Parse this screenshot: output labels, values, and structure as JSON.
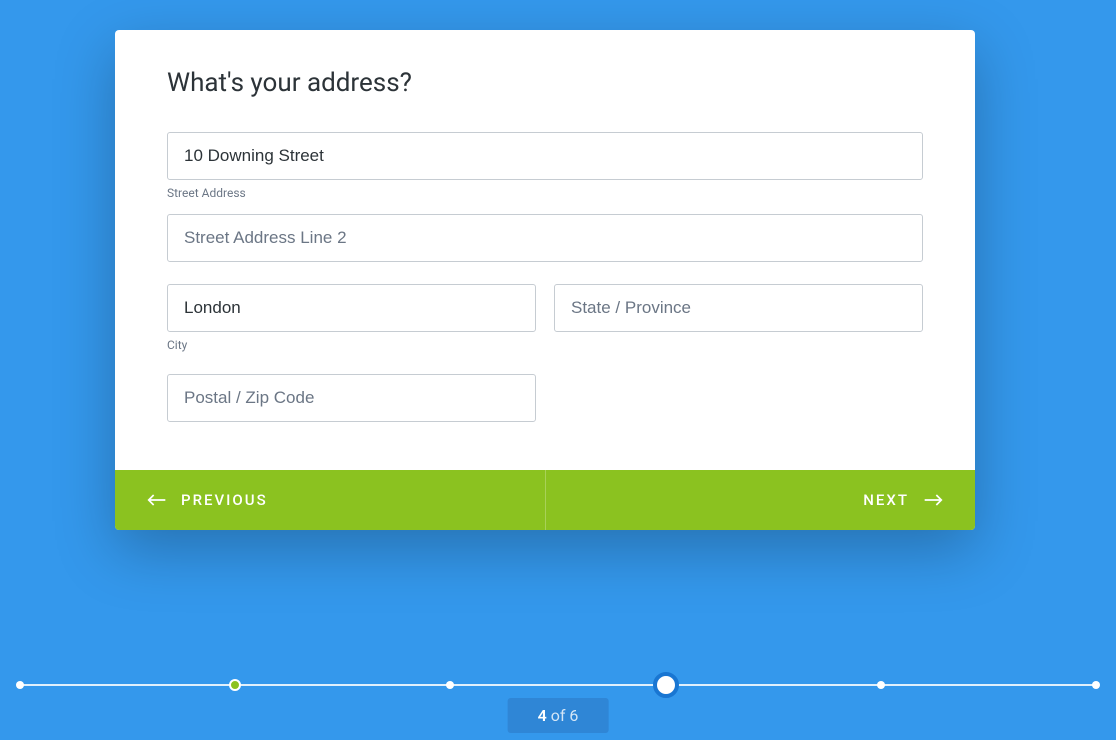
{
  "heading": "What's your address?",
  "fields": {
    "street": {
      "value": "10 Downing Street",
      "sublabel": "Street Address"
    },
    "street2": {
      "placeholder": "Street Address Line 2"
    },
    "city": {
      "value": "London",
      "sublabel": "City"
    },
    "state": {
      "placeholder": "State / Province"
    },
    "postal": {
      "placeholder": "Postal / Zip Code"
    }
  },
  "nav": {
    "prev": "PREVIOUS",
    "next": "NEXT"
  },
  "progress": {
    "current": 4,
    "total": 6,
    "of": " of ",
    "completed_index": 1,
    "current_index": 3
  },
  "colors": {
    "bg": "#3498ec",
    "accent": "#8bc220",
    "ring": "#1976d2"
  }
}
